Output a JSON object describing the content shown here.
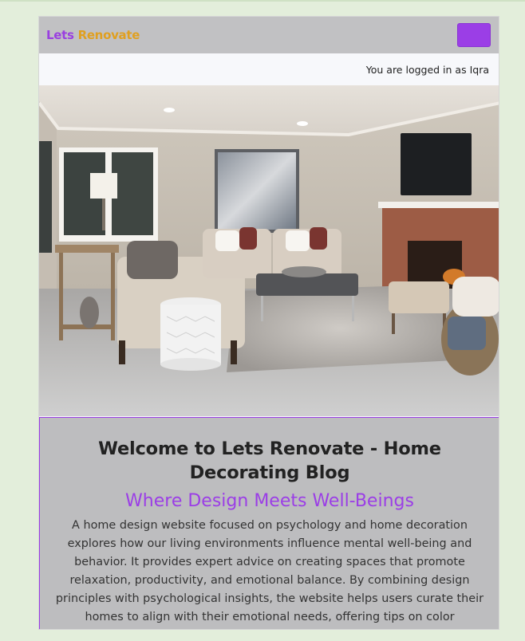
{
  "navbar": {
    "brand_part1": "Lets",
    "brand_part2": " Renovate",
    "menu_button_icon": "hamburger-menu-icon",
    "colors": {
      "navbar_bg": "#c1c1c3",
      "accent": "#9b3ee6",
      "brand_secondary": "#e0a020"
    }
  },
  "login_bar": {
    "text": "You are logged in as Iqra"
  },
  "hero": {
    "image_subject": "living-room-photo"
  },
  "welcome": {
    "title": "Welcome to Lets Renovate - Home Decorating Blog",
    "subtitle": "Where Design Meets Well-Beings",
    "description": "A home design website focused on psychology and home decoration explores how our living environments influence mental well-being and behavior. It provides expert advice on creating spaces that promote relaxation, productivity, and emotional balance. By combining design principles with psychological insights, the website helps users curate their homes to align with their emotional needs, offering tips on color psychology, lighting, layout, and"
  }
}
